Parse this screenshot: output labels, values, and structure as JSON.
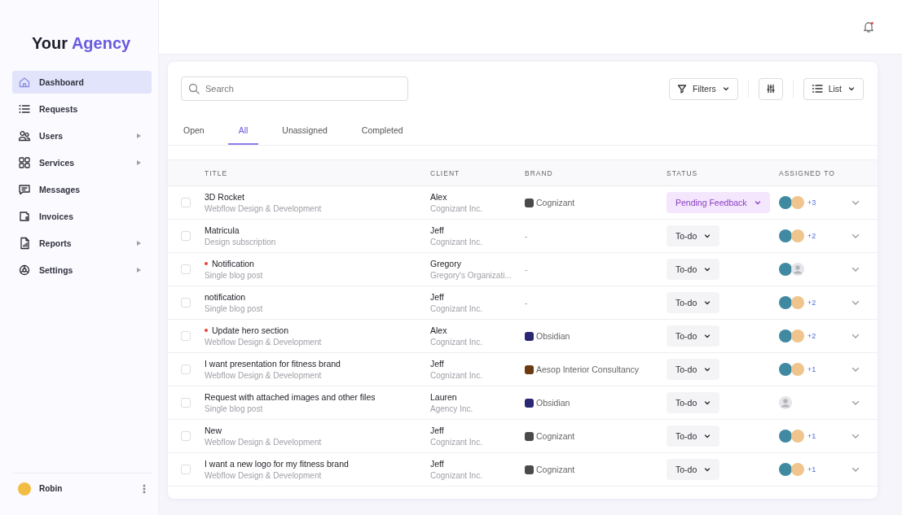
{
  "sidebar": {
    "logo": {
      "first": "Your",
      "second": "Agency"
    },
    "items": [
      {
        "label": "Dashboard",
        "selected": true,
        "expandable": false
      },
      {
        "label": "Requests",
        "selected": false,
        "expandable": false
      },
      {
        "label": "Users",
        "selected": false,
        "expandable": true
      },
      {
        "label": "Services",
        "selected": false,
        "expandable": true
      },
      {
        "label": "Messages",
        "selected": false,
        "expandable": false
      },
      {
        "label": "Invoices",
        "selected": false,
        "expandable": false
      },
      {
        "label": "Reports",
        "selected": false,
        "expandable": true
      },
      {
        "label": "Settings",
        "selected": false,
        "expandable": true
      }
    ],
    "user": {
      "name": "Robin"
    }
  },
  "toolbar": {
    "search": {
      "placeholder": "Search"
    },
    "filters": "Filters",
    "view": "List"
  },
  "tabs": [
    {
      "label": "Open",
      "selected": false
    },
    {
      "label": "All",
      "selected": true
    },
    {
      "label": "Unassigned",
      "selected": false
    },
    {
      "label": "Completed",
      "selected": false
    }
  ],
  "table": {
    "columns": [
      "TITLE",
      "CLIENT",
      "BRAND",
      "STATUS",
      "ASSIGNED TO"
    ],
    "rows": [
      {
        "checked": false,
        "flagged": false,
        "title": "3D Rocket",
        "subtitle": "Webflow Design & Development",
        "client": "Alex",
        "company": "Cognizant Inc.",
        "brand": {
          "name": "Cognizant",
          "color": "#4a4a4a"
        },
        "status": {
          "label": "Pending Feedback",
          "kind": "pending"
        },
        "avatars": [
          {
            "kind": "photo"
          },
          {
            "kind": "photo"
          }
        ],
        "extra": "+3"
      },
      {
        "checked": false,
        "flagged": false,
        "title": "Matricula",
        "subtitle": "Design subscription",
        "client": "Jeff",
        "company": "Cognizant Inc.",
        "brand": {
          "name": "-"
        },
        "status": {
          "label": "To-do",
          "kind": "todo"
        },
        "avatars": [
          {
            "kind": "photo"
          },
          {
            "kind": "photo"
          }
        ],
        "extra": "+2"
      },
      {
        "checked": false,
        "flagged": true,
        "title": "Notification",
        "subtitle": "Single blog post",
        "client": "Gregory",
        "company": "Gregory's Organizati...",
        "brand": {
          "name": "-"
        },
        "status": {
          "label": "To-do",
          "kind": "todo"
        },
        "avatars": [
          {
            "kind": "photo"
          },
          {
            "kind": "placeholder"
          }
        ]
      },
      {
        "checked": false,
        "flagged": false,
        "title": "notification",
        "subtitle": "Single blog post",
        "client": "Jeff",
        "company": "Cognizant Inc.",
        "brand": {
          "name": "-"
        },
        "status": {
          "label": "To-do",
          "kind": "todo"
        },
        "avatars": [
          {
            "kind": "photo"
          },
          {
            "kind": "photo"
          }
        ],
        "extra": "+2"
      },
      {
        "checked": false,
        "flagged": true,
        "title": "Update hero section",
        "subtitle": "Webflow Design & Development",
        "client": "Alex",
        "company": "Cognizant Inc.",
        "brand": {
          "name": "Obsidian",
          "color": "#2a2875"
        },
        "status": {
          "label": "To-do",
          "kind": "todo"
        },
        "avatars": [
          {
            "kind": "photo"
          },
          {
            "kind": "photo"
          }
        ],
        "extra": "+2"
      },
      {
        "checked": false,
        "flagged": false,
        "title": "I want presentation for fitness brand",
        "subtitle": "Webflow Design & Development",
        "client": "Jeff",
        "company": "Cognizant Inc.",
        "brand": {
          "name": "Aesop Interior Consultancy",
          "color": "#6b3a10"
        },
        "status": {
          "label": "To-do",
          "kind": "todo"
        },
        "avatars": [
          {
            "kind": "photo"
          },
          {
            "kind": "photo"
          }
        ],
        "extra": "+1"
      },
      {
        "checked": false,
        "flagged": false,
        "title": "Request with attached images and other files",
        "subtitle": "Single blog post",
        "client": "Lauren",
        "company": "Agency Inc.",
        "brand": {
          "name": "Obsidian",
          "color": "#2a2875"
        },
        "status": {
          "label": "To-do",
          "kind": "todo"
        },
        "avatars": [
          {
            "kind": "placeholder"
          }
        ]
      },
      {
        "checked": false,
        "flagged": false,
        "title": "New",
        "subtitle": "Webflow Design & Development",
        "client": "Jeff",
        "company": "Cognizant Inc.",
        "brand": {
          "name": "Cognizant",
          "color": "#4a4a4a"
        },
        "status": {
          "label": "To-do",
          "kind": "todo"
        },
        "avatars": [
          {
            "kind": "photo"
          },
          {
            "kind": "photo"
          }
        ],
        "extra": "+1"
      },
      {
        "checked": false,
        "flagged": false,
        "title": "I want a new logo for my fitness brand",
        "subtitle": "Webflow Design & Development",
        "client": "Jeff",
        "company": "Cognizant Inc.",
        "brand": {
          "name": "Cognizant",
          "color": "#4a4a4a"
        },
        "status": {
          "label": "To-do",
          "kind": "todo"
        },
        "avatars": [
          {
            "kind": "photo"
          },
          {
            "kind": "photo"
          }
        ],
        "extra": "+1"
      }
    ]
  }
}
